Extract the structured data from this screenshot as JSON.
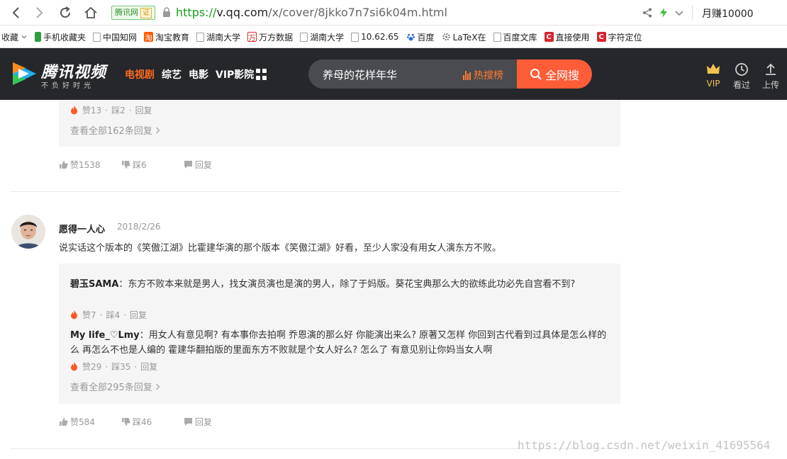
{
  "browser": {
    "site_tag": "腾讯网",
    "site_cert": "证",
    "url_scheme": "https://",
    "url_host": "v.qq.com",
    "url_path": "/x/cover/8jkko7n7si6k04m.html",
    "earn_label": "月赚10000"
  },
  "bookmarks": [
    {
      "label": "收藏",
      "icon": "chevron-down-icon"
    },
    {
      "label": "手机收藏夹",
      "icon": "phone-icon",
      "color": "#2e9e3e"
    },
    {
      "label": "中国知网",
      "icon": "page-icon"
    },
    {
      "label": "淘宝教育",
      "icon": "taobao-icon",
      "color": "#ff5a00"
    },
    {
      "label": "湖南大学",
      "icon": "page-icon"
    },
    {
      "label": "万方数据",
      "icon": "wanfang-icon",
      "color": "#d32d2d"
    },
    {
      "label": "湖南大学",
      "icon": "page-icon"
    },
    {
      "label": "10.62.65",
      "icon": "page-icon"
    },
    {
      "label": "百度",
      "icon": "baidu-paw-icon",
      "color": "#2b6de0"
    },
    {
      "label": "LaTeX在",
      "icon": "gear-icon",
      "color": "#777777"
    },
    {
      "label": "百度文库",
      "icon": "page-icon"
    },
    {
      "label": "直接使用",
      "icon": "c-logo-icon",
      "color": "#d9232d"
    },
    {
      "label": "字符定位",
      "icon": "c-logo-icon",
      "color": "#d9232d"
    }
  ],
  "site": {
    "logo_text": "腾讯视频",
    "logo_sub": "不负好时光",
    "nav": [
      "电视剧",
      "综艺",
      "电影",
      "VIP影院"
    ],
    "nav_active_index": 0,
    "search_query": "养母的花样年华",
    "hot_label": "热搜榜",
    "search_button": "全网搜",
    "tools": [
      {
        "label": "VIP",
        "icon": "crown-icon"
      },
      {
        "label": "看过",
        "icon": "clock-icon"
      },
      {
        "label": "上传",
        "icon": "upload-icon"
      }
    ],
    "accent": "#ff5c38"
  },
  "thread_top": {
    "reply_meta": {
      "likes": "赞13",
      "dislikes": "踩2",
      "reply": "回复"
    },
    "view_all": "查看全部162条回复",
    "actions": {
      "likes": "赞1538",
      "dislikes": "踩6",
      "reply": "回复"
    }
  },
  "comment": {
    "user": "愿得一人心",
    "date": "2018/2/26",
    "text": "说实话这个版本的《笑傲江湖》比霍建华演的那个版本《笑傲江湖》好看，至少人家没有用女人演东方不败。",
    "replies": [
      {
        "user": "碧玉SAMA",
        "text": "：东方不败本来就是男人，找女演员演也是演的男人，除了于妈版。葵花宝典那么大的欲练此功必先自宫看不到?",
        "likes": "赞7",
        "dislikes": "踩4",
        "reply": "回复"
      },
      {
        "user": "My life_♡Lmy",
        "text": "：用女人有意见啊? 有本事你去拍啊 乔恩演的那么好 你能演出来么? 原著又怎样 你回到古代看到过具体是怎么样的么 再怎么不也是人编的 霍建华翻拍版的里面东方不败就是个女人好么? 怎么了 有意见别让你妈当女人啊",
        "likes": "赞29",
        "dislikes": "踩35",
        "reply": "回复"
      }
    ],
    "view_all": "查看全部295条回复",
    "actions": {
      "likes": "赞584",
      "dislikes": "踩46",
      "reply": "回复"
    }
  },
  "watermark": "https://blog.csdn.net/weixin_41695564"
}
